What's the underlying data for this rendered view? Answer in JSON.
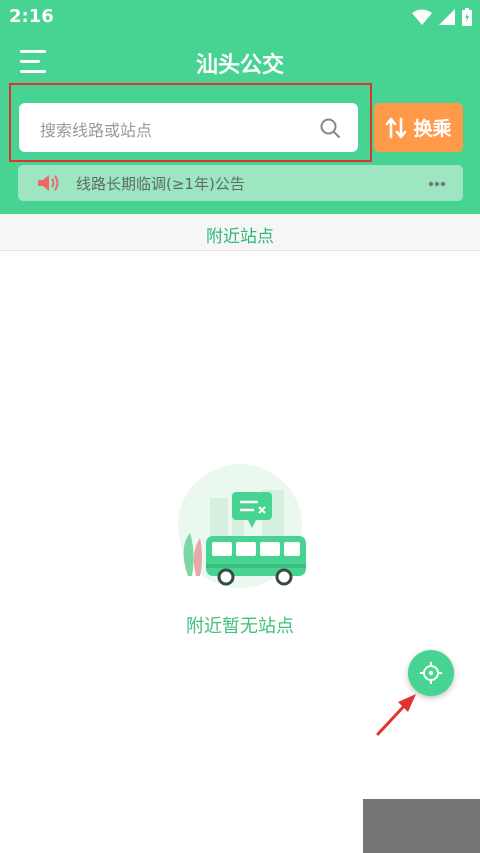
{
  "status_bar": {
    "time": "2:16"
  },
  "header": {
    "title": "汕头公交"
  },
  "search": {
    "placeholder": "搜索线路或站点"
  },
  "transfer_button": {
    "label": "换乘"
  },
  "notice": {
    "text": "线路长期临调(≥1年)公告"
  },
  "nearby": {
    "title": "附近站点",
    "empty_text": "附近暂无站点"
  },
  "colors": {
    "primary_green": "#47d492",
    "orange": "#ff9a4a",
    "annotation_red": "#e0322f"
  },
  "icons": [
    "menu-icon",
    "search-icon",
    "transfer-icon",
    "speaker-icon",
    "more-icon",
    "locate-icon",
    "wifi-icon",
    "signal-icon",
    "battery-icon"
  ]
}
